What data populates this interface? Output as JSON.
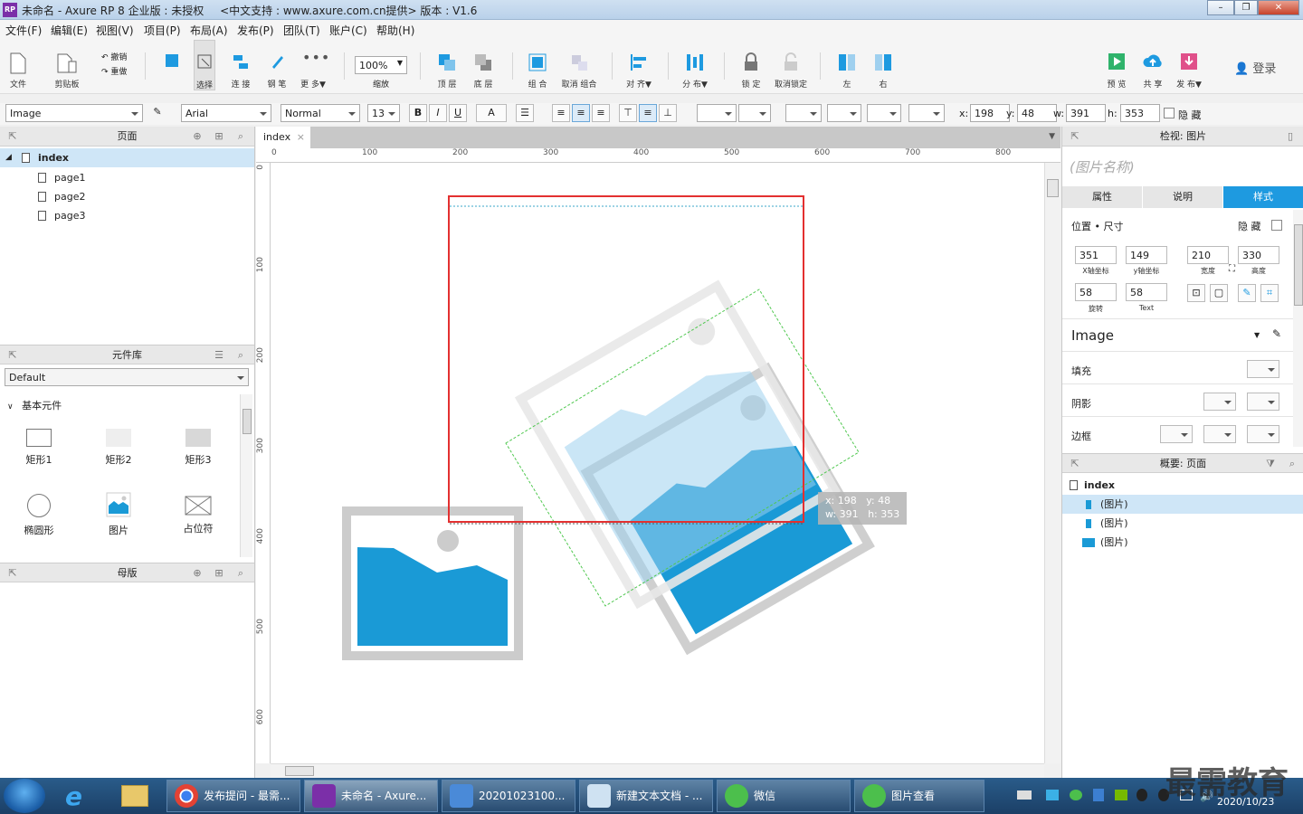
{
  "window": {
    "app_name": "未命名 - Axure RP 8 企业版 : 未授权",
    "support_text": "<中文支持 : www.axure.com.cn提供> 版本 : V1.6",
    "logo": "RP"
  },
  "menu": [
    "文件(F)",
    "编辑(E)",
    "视图(V)",
    "项目(P)",
    "布局(A)",
    "发布(P)",
    "团队(T)",
    "账户(C)",
    "帮助(H)"
  ],
  "toolbar": {
    "file": "文件",
    "clipboard": "剪贴板",
    "undo": "撤销",
    "redo": "重做",
    "select": "选择",
    "connect": "连 接",
    "pen": "钢 笔",
    "more": "更 多▼",
    "zoom_value": "100%",
    "zoom_label": "缩放",
    "top": "顶 层",
    "bottom": "底 层",
    "group": "组 合",
    "ungroup": "取消 组合",
    "align": "对 齐▼",
    "distribute": "分 布▼",
    "lock": "锁 定",
    "unlock": "取消锁定",
    "left": "左",
    "right": "右",
    "preview": "预 览",
    "share": "共 享",
    "publish": "发 布▼",
    "login": "登录"
  },
  "formatbar": {
    "widget_type": "Image",
    "font_family": "Arial",
    "font_style": "Normal",
    "font_size": "13",
    "bold": "B",
    "italic": "I",
    "underline": "U",
    "font_color": "A",
    "x_label": "x:",
    "x_value": "198",
    "y_label": "y:",
    "y_value": "48",
    "w_label": "w:",
    "w_value": "391",
    "h_label": "h:",
    "h_value": "353",
    "hidden_label": "隐 藏"
  },
  "pages_panel": {
    "title": "页面",
    "root": "index",
    "children": [
      "page1",
      "page2",
      "page3"
    ]
  },
  "library_panel": {
    "title": "元件库",
    "library": "Default",
    "category": "基本元件",
    "items": [
      "矩形1",
      "矩形2",
      "矩形3",
      "椭圆形",
      "图片",
      "占位符"
    ]
  },
  "masters_panel": {
    "title": "母版"
  },
  "canvas": {
    "tab": "index",
    "ruler_h": [
      "0",
      "100",
      "200",
      "300",
      "400",
      "500",
      "600",
      "700",
      "800"
    ],
    "ruler_v": [
      "0",
      "100",
      "200",
      "300",
      "400",
      "500",
      "600"
    ],
    "tooltip_line1": "x: 198   y: 48",
    "tooltip_line2": "w: 391   h: 353"
  },
  "inspector": {
    "title": "检视: 图片",
    "name_placeholder": "(图片名称)",
    "tabs": [
      "属性",
      "说明",
      "样式"
    ],
    "active_tab": "样式",
    "position_size": "位置 • 尺寸",
    "hide": "隐 藏",
    "x": "351",
    "x_label": "X轴坐标",
    "y": "149",
    "y_label": "y轴坐标",
    "width": "210",
    "width_label": "宽度",
    "height": "330",
    "height_label": "高度",
    "rotation": "58",
    "rotation_label": "旋转",
    "text_rotation": "58",
    "text_rotation_label": "Text",
    "style_name": "Image",
    "fill": "填充",
    "shadow": "阴影",
    "border": "边框"
  },
  "outline_panel": {
    "title": "概要: 页面",
    "root": "index",
    "items": [
      "(图片)",
      "(图片)",
      "(图片)"
    ]
  },
  "taskbar": {
    "items": [
      "发布提问 - 最需...",
      "未命名 - Axure...",
      "20201023100...",
      "新建文本文档 - ...",
      "微信",
      "图片查看"
    ],
    "date": "2020/10/23",
    "watermark": "最需教育"
  },
  "colors": {
    "accent": "#1e9ae0",
    "image_blue": "#1a9ad6",
    "selection_red": "#e33030",
    "guide_green": "#50c850"
  }
}
